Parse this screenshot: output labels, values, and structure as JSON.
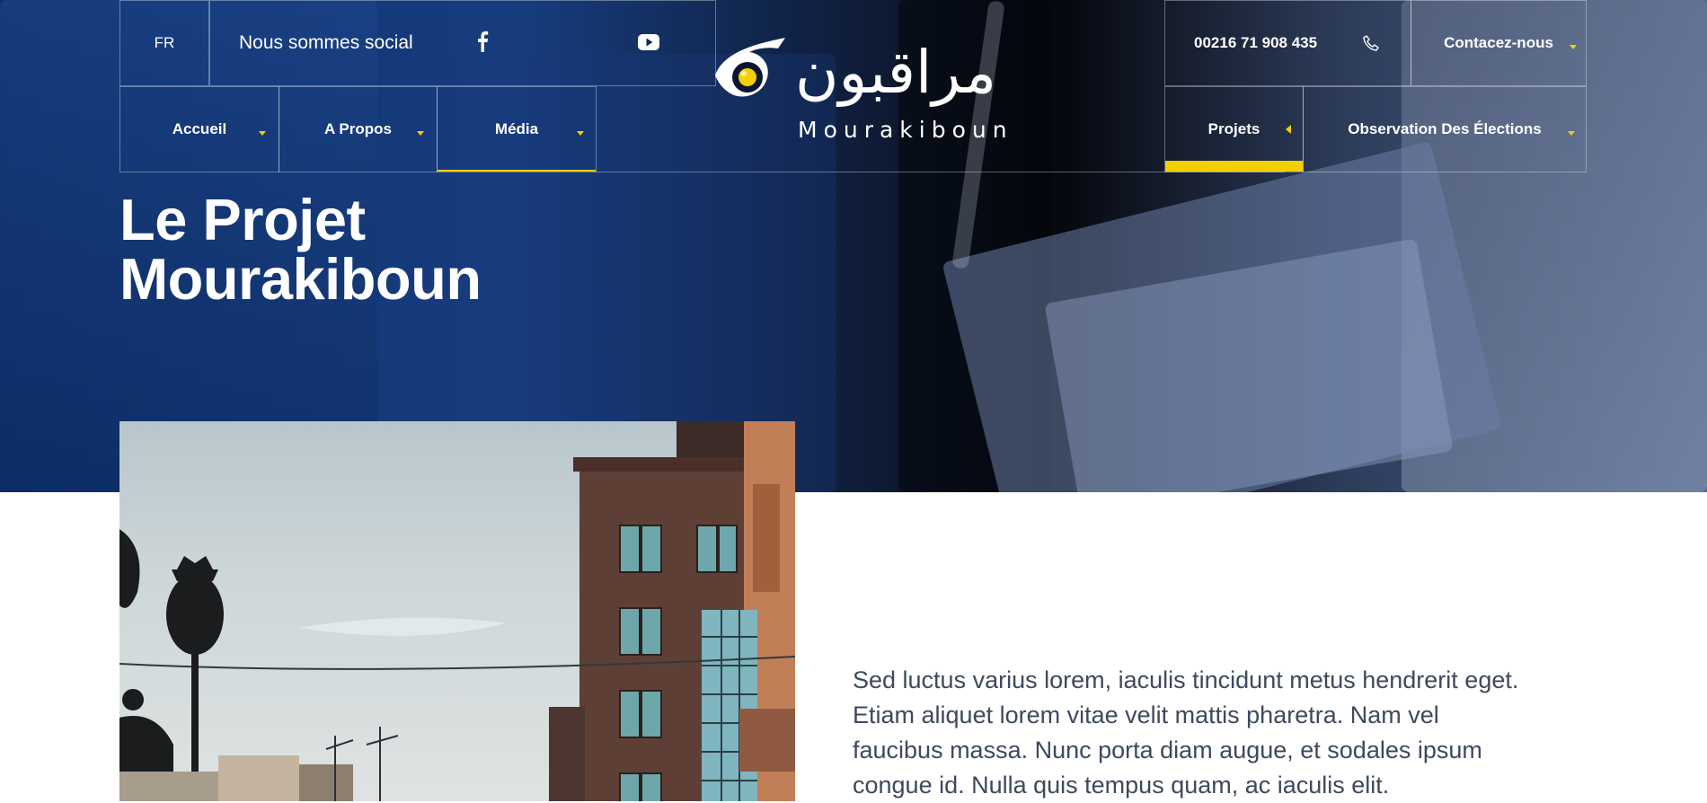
{
  "colors": {
    "accent": "#f5cf00",
    "hero_blue": "#173d7f",
    "text": "#3e4a5c"
  },
  "topbar": {
    "lang": "FR",
    "social_label": "Nous sommes social",
    "social_icons": [
      "facebook-icon",
      "youtube-icon"
    ],
    "phone": "00216 71 908 435",
    "phone_icon": "phone-icon",
    "contact_label": "Contacez-nous"
  },
  "logo": {
    "arabic": "مراقبون",
    "latin": "Mourakiboun"
  },
  "nav": {
    "left": [
      {
        "label": "Accueil"
      },
      {
        "label": "A Propos"
      },
      {
        "label": "Média"
      }
    ],
    "right": [
      {
        "label": "Projets"
      },
      {
        "label": "Observation Des Élections"
      }
    ]
  },
  "hero": {
    "title_line1": "Le Projet",
    "title_line2": "Mourakiboun"
  },
  "content": {
    "paragraph": "Sed luctus varius lorem, iaculis tincidunt metus hendrerit eget. Etiam aliquet lorem vitae velit mattis pharetra. Nam vel faucibus massa. Nunc porta diam augue, et sodales ipsum congue id. Nulla quis tempus quam, ac iaculis elit."
  }
}
